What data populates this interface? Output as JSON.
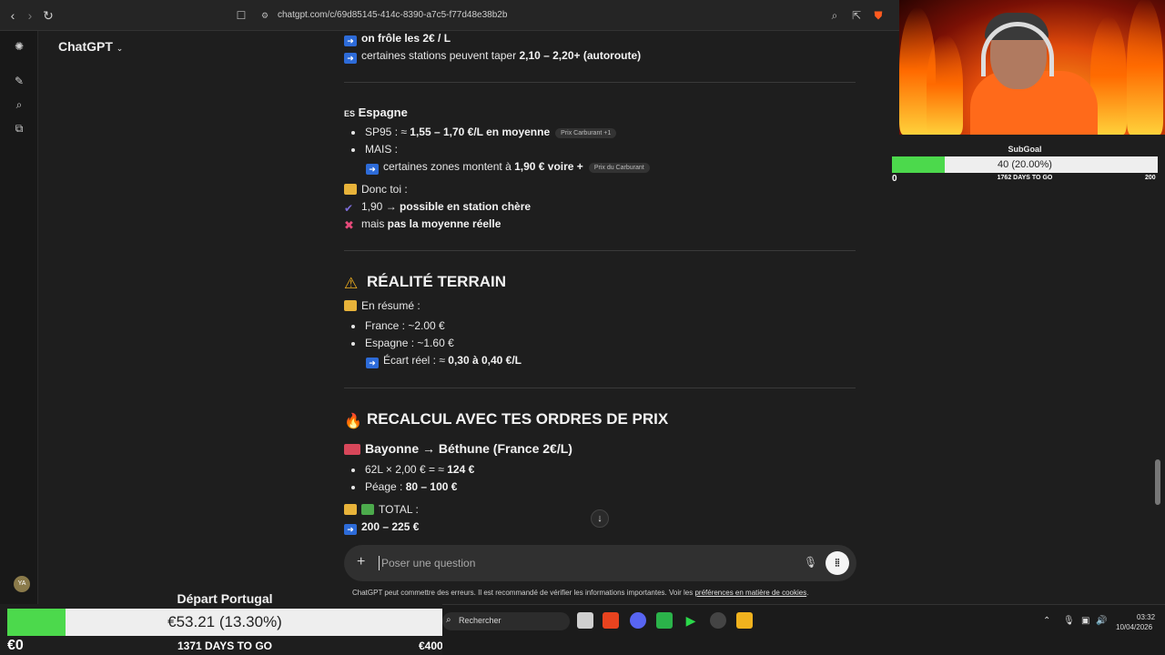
{
  "browser": {
    "url": "chatgpt.com/c/69d85145-414c-8390-a7c5-f77d48e38b2b"
  },
  "app": {
    "brand": "ChatGPT",
    "avatar_initials": "YA"
  },
  "chat": {
    "top_lines": {
      "l1_bold": "on frôle les 2€ / L",
      "l2_text": "certaines stations peuvent taper ",
      "l2_bold": "2,10 – 2,20+ (autoroute)"
    },
    "spain": {
      "flag": "ES",
      "heading": "Espagne",
      "b1_text": "SP95 : ≈ ",
      "b1_bold": "1,55 – 1,70 €/L en moyenne",
      "b1_chip": "Prix Carburant  +1",
      "b2_text": "MAIS :",
      "b2_sub_text": "certaines zones montent à ",
      "b2_sub_bold": "1,90 € voire +",
      "b2_sub_chip": "Prix du Carburant",
      "donc": "Donc toi :",
      "check_text": "1,90 → ",
      "check_bold": "possible en station chère",
      "cross_text": "mais ",
      "cross_bold": "pas la moyenne réelle"
    },
    "reality": {
      "heading": "RÉALITÉ TERRAIN",
      "summary": "En résumé :",
      "b1": "France : ~2.00 €",
      "b2": "Espagne : ~1.60 €",
      "gap_text": "Écart réel : ≈ ",
      "gap_bold": "0,30 à 0,40 €/L"
    },
    "recalc": {
      "heading": "RECALCUL AVEC TES ORDRES DE PRIX",
      "route": "Bayonne → Béthune (France 2€/L)",
      "b1_text": "62L × 2,00 € = ≈ ",
      "b1_bold": "124 €",
      "b2_text": "Péage : ",
      "b2_bold": "80 – 100 €",
      "total": "TOTAL :",
      "total_value": "200 – 225 €"
    }
  },
  "composer": {
    "placeholder": "Poser une question",
    "disclaimer_text": "ChatGPT peut commettre des erreurs. Il est recommandé de vérifier les informations importantes. Voir les ",
    "disclaimer_link": "préférences en matière de cookies",
    "disclaimer_end": "."
  },
  "subgoal": {
    "title": "SubGoal",
    "progress_label": "40 (20.00%)",
    "progress_fraction": 0.2,
    "min": "0",
    "days": "1762 DAYS TO GO",
    "max": "200"
  },
  "goal": {
    "title": "Départ Portugal",
    "progress_label": "€53.21 (13.30%)",
    "progress_fraction": 0.133,
    "min": "€0",
    "days": "1371 DAYS TO GO",
    "max": "€400"
  },
  "taskbar": {
    "search_label": "Rechercher",
    "time": "03:32",
    "date": "10/04/2026"
  }
}
